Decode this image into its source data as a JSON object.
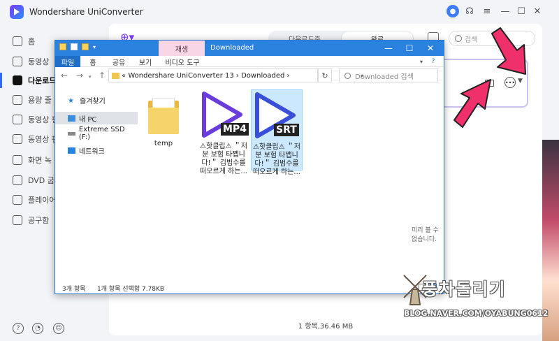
{
  "uniconverter": {
    "title": "Wondershare UniConverter",
    "sidebar": [
      {
        "label": "홈"
      },
      {
        "label": "동영상"
      },
      {
        "label": "다운로드"
      },
      {
        "label": "용량 줄"
      },
      {
        "label": "동영상 편"
      },
      {
        "label": "동영상 편"
      },
      {
        "label": "화면 녹"
      },
      {
        "label": "DVD 굽"
      },
      {
        "label": "플레이어"
      },
      {
        "label": "공구함"
      }
    ],
    "tabs": {
      "downloading": "다운로드중",
      "done": "완료"
    },
    "search_placeholder": "검색",
    "footer": "1 항목,36.46 MB"
  },
  "explorer": {
    "context_tab": "재생",
    "title": "Downloaded",
    "ribbon": {
      "file": "파일",
      "home": "홈",
      "share": "공유",
      "view": "보기",
      "video_tools": "비디오 도구"
    },
    "address": {
      "prefix": "«",
      "path1": "Wondershare UniConverter 13",
      "sep": "›",
      "path2": "Downloaded",
      "sep2": "›"
    },
    "search_placeholder": "Downloaded 검색",
    "nav": [
      {
        "label": "즐겨찾기"
      },
      {
        "label": "내 PC"
      },
      {
        "label": "Extreme SSD (F:)"
      },
      {
        "label": "네트워크"
      }
    ],
    "files": [
      {
        "name": "temp",
        "type": "folder"
      },
      {
        "name": "⚠핫클립⚠ ＂저 분 보험 타쨉니다!＂ 김범수를 떠오르게 하는...",
        "badge": "MP4"
      },
      {
        "name": "⚠핫클립⚠ ＂저 분 보험 타쨉니다!＂ 김범수를 떠오르게 하는...",
        "badge": "SRT"
      }
    ],
    "preview_text": "미리 볼 수 없습니다.",
    "status": {
      "count": "3개 항목",
      "selected": "1개 항목 선택함 7.78KB"
    }
  },
  "watermark": {
    "title": "풍차돌리기",
    "url": "BLOG.NAVER.COM/OYABUNG0612"
  },
  "colors": {
    "explorer_title": "#2b82de",
    "arrow": "#f0306a",
    "accent": "#7a3cff"
  }
}
